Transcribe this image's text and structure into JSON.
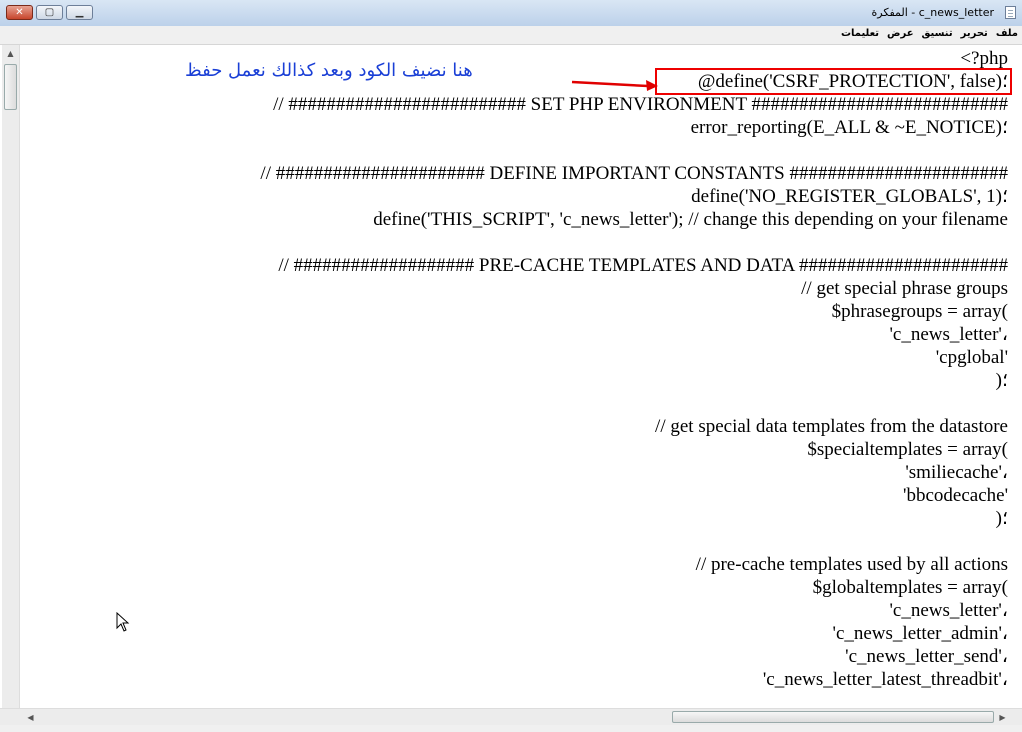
{
  "window": {
    "title": "c_news_letter - المفكرة",
    "buttons": {
      "close": "✕",
      "maximize": "▢",
      "minimize": "▁"
    }
  },
  "menu": [
    "ملف",
    "تحرير",
    "تنسيق",
    "عرض",
    "تعليمات"
  ],
  "code_lines": [
    "<?php",
    "@define('CSRF_PROTECTION', false)؛",
    "// ######################### SET PHP ENVIRONMENT ###########################",
    "error_reporting(E_ALL & ~E_NOTICE)؛",
    "",
    "// ###################### DEFINE IMPORTANT CONSTANTS #######################",
    "define('NO_REGISTER_GLOBALS', 1)؛",
    "define('THIS_SCRIPT', 'c_news_letter'); // change this depending on your filename",
    "",
    "// ################### PRE-CACHE TEMPLATES AND DATA ######################",
    "// get special phrase groups",
    "$phrasegroups = array(",
    "'c_news_letter'،",
    "'cpglobal'",
    ")؛",
    "",
    "// get special data templates from the datastore",
    "$specialtemplates = array(",
    "'smiliecache'،",
    "'bbcodecache'",
    ")؛",
    "",
    "// pre-cache templates used by all actions",
    "$globaltemplates = array(",
    "'c_news_letter'،",
    "'c_news_letter_admin'،",
    "'c_news_letter_send'،",
    "'c_news_letter_latest_threadbit'،"
  ],
  "annotation": {
    "text": "هنا نضيف الكود وبعد كذالك نعمل حفظ",
    "text_color": "#1a3fd6",
    "box_color": "#e00000"
  },
  "icons": {
    "app": "notepad-icon",
    "cursor": "mouse-pointer-icon"
  }
}
